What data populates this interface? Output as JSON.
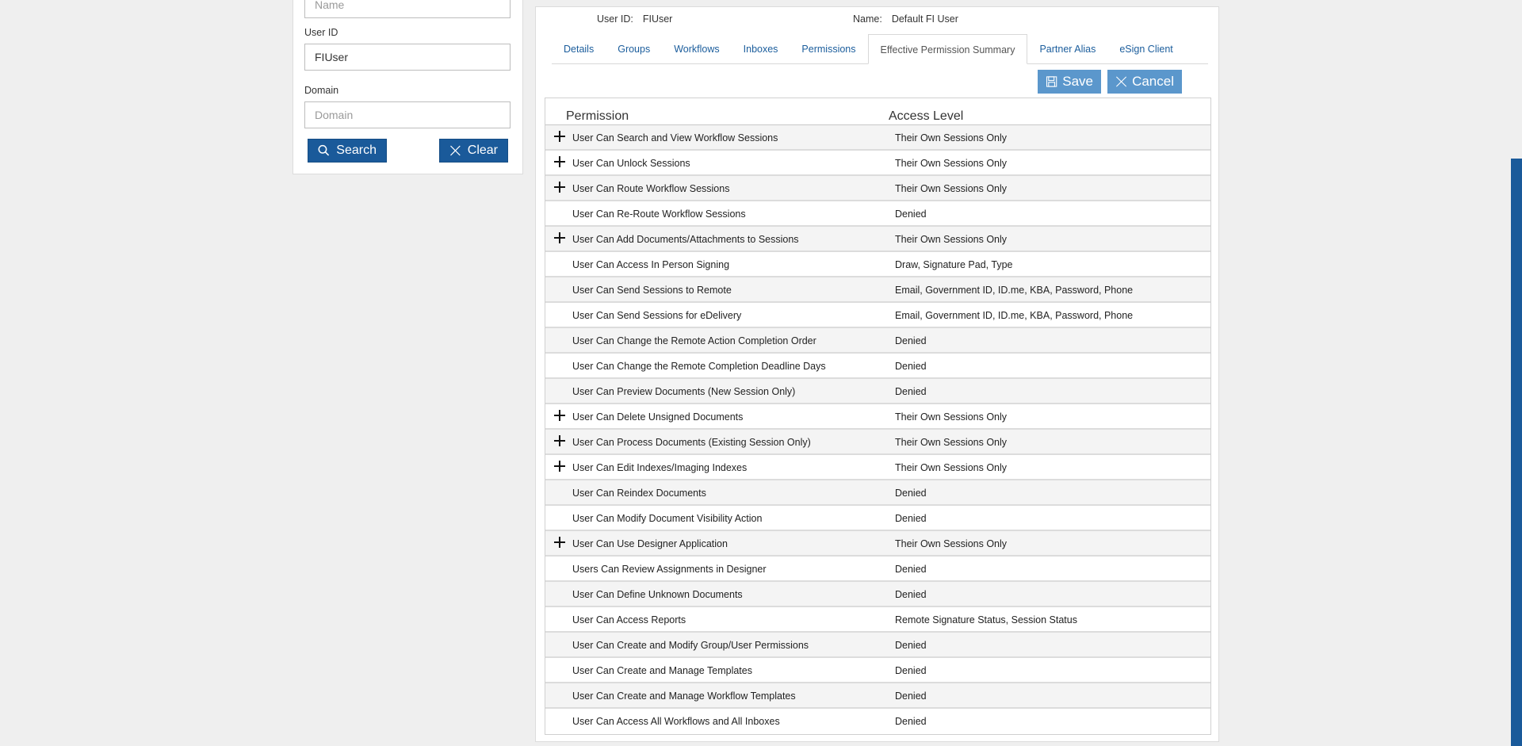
{
  "search_panel": {
    "name_placeholder": "Name",
    "userid_label": "User ID",
    "userid_value": "FIUser",
    "domain_label": "Domain",
    "domain_placeholder": "Domain",
    "search_label": "Search",
    "clear_label": "Clear"
  },
  "user_info": {
    "userid_label": "User ID:",
    "userid_value": "FIUser",
    "name_label": "Name:",
    "name_value": "Default FI User"
  },
  "tabs": [
    {
      "label": "Details"
    },
    {
      "label": "Groups"
    },
    {
      "label": "Workflows"
    },
    {
      "label": "Inboxes"
    },
    {
      "label": "Permissions"
    },
    {
      "label": "Effective Permission Summary",
      "active": true
    },
    {
      "label": "Partner Alias"
    },
    {
      "label": "eSign Client"
    }
  ],
  "actions": {
    "save_label": "Save",
    "cancel_label": "Cancel"
  },
  "grid": {
    "col_permission": "Permission",
    "col_access": "Access Level",
    "rows": [
      {
        "perm": "User Can Search and View Workflow Sessions",
        "level": "Their Own Sessions Only",
        "expandable": true
      },
      {
        "perm": "User Can Unlock Sessions",
        "level": "Their Own Sessions Only",
        "expandable": true
      },
      {
        "perm": "User Can Route Workflow Sessions",
        "level": "Their Own Sessions Only",
        "expandable": true
      },
      {
        "perm": "User Can Re-Route Workflow Sessions",
        "level": "Denied",
        "expandable": false
      },
      {
        "perm": "User Can Add Documents/Attachments to Sessions",
        "level": "Their Own Sessions Only",
        "expandable": true
      },
      {
        "perm": "User Can Access In Person Signing",
        "level": "Draw, Signature Pad, Type",
        "expandable": false
      },
      {
        "perm": "User Can Send Sessions to Remote",
        "level": "Email, Government ID, ID.me, KBA, Password, Phone",
        "expandable": false
      },
      {
        "perm": "User Can Send Sessions for eDelivery",
        "level": "Email, Government ID, ID.me, KBA, Password, Phone",
        "expandable": false
      },
      {
        "perm": "User Can Change the Remote Action Completion Order",
        "level": "Denied",
        "expandable": false
      },
      {
        "perm": "User Can Change the Remote Completion Deadline Days",
        "level": "Denied",
        "expandable": false
      },
      {
        "perm": "User Can Preview Documents (New Session Only)",
        "level": "Denied",
        "expandable": false
      },
      {
        "perm": "User Can Delete Unsigned Documents",
        "level": "Their Own Sessions Only",
        "expandable": true
      },
      {
        "perm": "User Can Process Documents (Existing Session Only)",
        "level": "Their Own Sessions Only",
        "expandable": true
      },
      {
        "perm": "User Can Edit Indexes/Imaging Indexes",
        "level": "Their Own Sessions Only",
        "expandable": true
      },
      {
        "perm": "User Can Reindex Documents",
        "level": "Denied",
        "expandable": false
      },
      {
        "perm": "User Can Modify Document Visibility Action",
        "level": "Denied",
        "expandable": false
      },
      {
        "perm": "User Can Use Designer Application",
        "level": "Their Own Sessions Only",
        "expandable": true
      },
      {
        "perm": "Users Can Review Assignments in Designer",
        "level": "Denied",
        "expandable": false
      },
      {
        "perm": "User Can Define Unknown Documents",
        "level": "Denied",
        "expandable": false
      },
      {
        "perm": "User Can Access Reports",
        "level": "Remote Signature Status, Session Status",
        "expandable": false
      },
      {
        "perm": "User Can Create and Modify Group/User Permissions",
        "level": "Denied",
        "expandable": false
      },
      {
        "perm": "User Can Create and Manage Templates",
        "level": "Denied",
        "expandable": false
      },
      {
        "perm": "User Can Create and Manage Workflow Templates",
        "level": "Denied",
        "expandable": false
      },
      {
        "perm": "User Can Access All Workflows and All Inboxes",
        "level": "Denied",
        "expandable": false
      }
    ]
  },
  "colors": {
    "primary_button": "#1a5a9a",
    "action_button": "#5b97cc",
    "tab_link": "#1b5d9c"
  }
}
